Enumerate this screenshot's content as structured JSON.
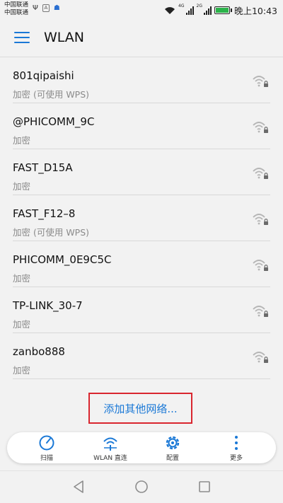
{
  "status_bar": {
    "carrier_1": "中国联通",
    "carrier_2": "中国联通",
    "network_tag_1": "4G",
    "network_tag_2": "2G",
    "time": "晚上10:43",
    "battery_color": "#2bb34a"
  },
  "app_bar": {
    "title": "WLAN"
  },
  "networks": [
    {
      "ssid": "801qipaishi",
      "security": "加密 (可使用 WPS)"
    },
    {
      "ssid": "@PHICOMM_9C",
      "security": "加密"
    },
    {
      "ssid": "FAST_D15A",
      "security": "加密"
    },
    {
      "ssid": "FAST_F12–8",
      "security": "加密 (可使用 WPS)"
    },
    {
      "ssid": "PHICOMM_0E9C5C",
      "security": "加密"
    },
    {
      "ssid": "TP-LINK_30-7",
      "security": "加密"
    },
    {
      "ssid": "zanbo888",
      "security": "加密"
    }
  ],
  "add_network": {
    "label": "添加其他网络..."
  },
  "toolbar": {
    "scan_label": "扫描",
    "direct_label": "WLAN 直连",
    "config_label": "配置",
    "more_label": "更多"
  },
  "colors": {
    "accent": "#1a78d6",
    "highlight_border": "#d9262f",
    "wifi_icon": "#b5b5b5"
  }
}
